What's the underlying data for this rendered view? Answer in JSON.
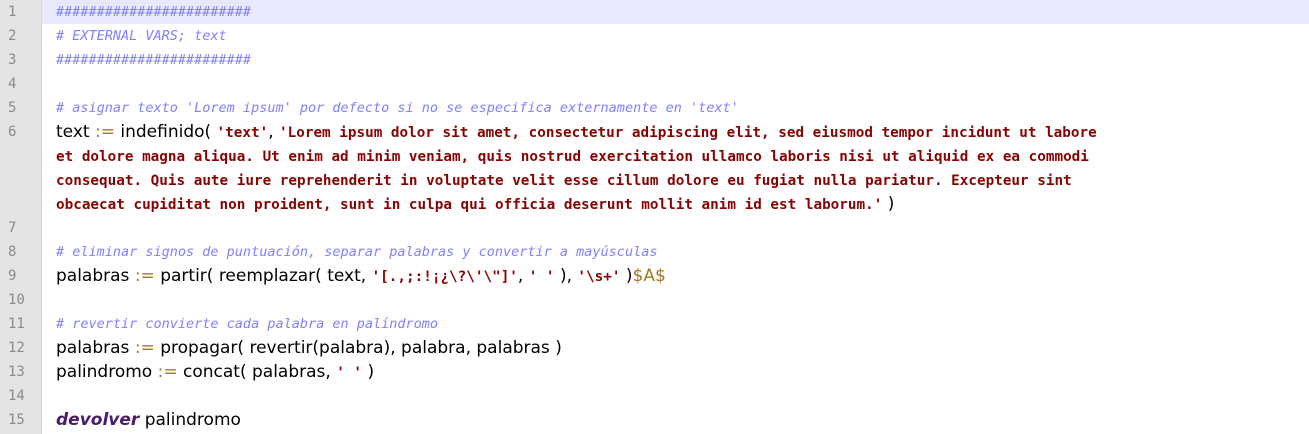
{
  "editor": {
    "colors": {
      "background": "#ffffff",
      "gutter": "#e4e4e4",
      "current_line": "#e8e8ff",
      "comment": "#8080ff",
      "string": "#8b0000",
      "operator": "#a07820",
      "keyword": "#4b1b6b"
    },
    "lines": [
      {
        "number": "1",
        "comment": "########################"
      },
      {
        "number": "2",
        "comment": "# EXTERNAL VARS; text"
      },
      {
        "number": "3",
        "comment": "########################"
      },
      {
        "number": "4"
      },
      {
        "number": "5",
        "comment": "# asignar texto 'Lorem ipsum' por defecto si no se especifica externamente en 'text'"
      },
      {
        "number": "6",
        "var": "text",
        "op": ":=",
        "func": "indefinido(",
        "arg1": "'text'",
        "comma": ",",
        "wrap": [
          "'Lorem ipsum dolor sit amet, consectetur adipiscing elit, sed eiusmod tempor incidunt ut labore",
          "et dolore magna aliqua. Ut enim ad minim veniam, quis nostrud exercitation ullamco laboris nisi ut aliquid ex ea commodi",
          "consequat. Quis aute iure reprehenderit in voluptate velit esse cillum dolore eu fugiat nulla pariatur. Excepteur sint",
          "obcaecat cupiditat non proident, sunt in culpa qui officia deserunt mollit anim id est laborum.'"
        ],
        "close": ")"
      },
      {
        "number": "7"
      },
      {
        "number": "8",
        "comment": "# eliminar signos de puntuación, separar palabras y convertir a mayúsculas"
      },
      {
        "number": "9",
        "var": "palabras",
        "op": ":=",
        "p1": "partir( reemplazar( text,",
        "s1": "'[.,;:!¡¿\\?\\'\\\"]'",
        "p2": ",",
        "s2": "' '",
        "p3": "),",
        "s3": "'\\s+'",
        "p4": ")",
        "s4": "$A$"
      },
      {
        "number": "10"
      },
      {
        "number": "11",
        "comment": "# revertir convierte cada palabra en palíndromo"
      },
      {
        "number": "12",
        "var": "palabras",
        "op": ":=",
        "rest": "propagar( revertir(palabra), palabra, palabras )"
      },
      {
        "number": "13",
        "var": "palindromo",
        "op": ":=",
        "p1": "concat( palabras,",
        "s1": "' '",
        "p2": ")"
      },
      {
        "number": "14"
      },
      {
        "number": "15",
        "keyword": "devolver",
        "rest": "palindromo"
      }
    ]
  }
}
